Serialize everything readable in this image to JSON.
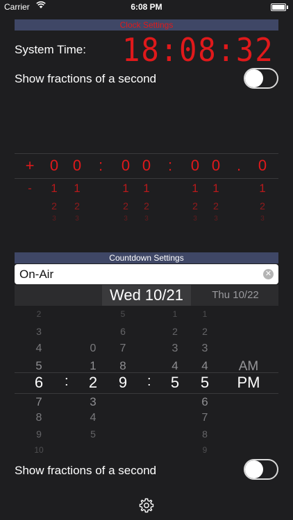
{
  "status_bar": {
    "carrier": "Carrier",
    "time": "6:08 PM"
  },
  "clock_settings": {
    "header": "Clock Settings",
    "system_time_label": "System Time:",
    "system_time_value": "18:08:32",
    "fractions_label": "Show fractions of a second",
    "fractions_toggle_on": false
  },
  "offset_picker": {
    "columns": [
      {
        "selected": "+",
        "n1": "-",
        "n2": "",
        "n3": ""
      },
      {
        "selected": "0",
        "n1": "1",
        "n2": "2",
        "n3": "3"
      },
      {
        "selected": "0",
        "n1": "1",
        "n2": "2",
        "n3": "3"
      },
      {
        "selected": ":",
        "n1": "",
        "n2": "",
        "n3": ""
      },
      {
        "selected": "0",
        "n1": "1",
        "n2": "2",
        "n3": "3"
      },
      {
        "selected": "0",
        "n1": "1",
        "n2": "2",
        "n3": "3"
      },
      {
        "selected": ":",
        "n1": "",
        "n2": "",
        "n3": ""
      },
      {
        "selected": "0",
        "n1": "1",
        "n2": "2",
        "n3": "3"
      },
      {
        "selected": "0",
        "n1": "1",
        "n2": "2",
        "n3": "3"
      },
      {
        "selected": ".",
        "n1": "",
        "n2": "",
        "n3": ""
      },
      {
        "selected": "0",
        "n1": "1",
        "n2": "2",
        "n3": "3"
      }
    ]
  },
  "countdown_settings": {
    "header": "Countdown Settings",
    "name_value": "On-Air",
    "date_selected": "Wed 10/21",
    "date_next": "Thu 10/22",
    "hour": {
      "above": [
        "2",
        "3",
        "4",
        "5"
      ],
      "selected": "6",
      "below": [
        "7",
        "8",
        "9",
        "10"
      ]
    },
    "minute_tens": {
      "above": [
        "0",
        "1"
      ],
      "selected": "2",
      "below": [
        "3",
        "4",
        "5"
      ]
    },
    "minute_ones": {
      "above": [
        "5",
        "6",
        "7",
        "8"
      ],
      "selected": "9",
      "below": []
    },
    "second_tens": {
      "above": [
        "1",
        "2",
        "3",
        "4"
      ],
      "selected": "5",
      "below": []
    },
    "second_ones": {
      "above": [
        "1",
        "2",
        "3",
        "4"
      ],
      "selected": "5",
      "below": [
        "6",
        "7",
        "8",
        "9"
      ]
    },
    "ampm": {
      "above": [
        "AM"
      ],
      "selected": "PM"
    },
    "separator": ":",
    "fractions_label": "Show fractions of a second",
    "fractions_toggle_on": false
  },
  "icons": {
    "wifi": "wifi-icon",
    "battery": "battery-icon",
    "clear": "clear-circle-icon",
    "settings": "gear-icon"
  },
  "colors": {
    "accent_red": "#e0191b",
    "header_bg": "#3f4766",
    "background": "#1e1e20"
  }
}
